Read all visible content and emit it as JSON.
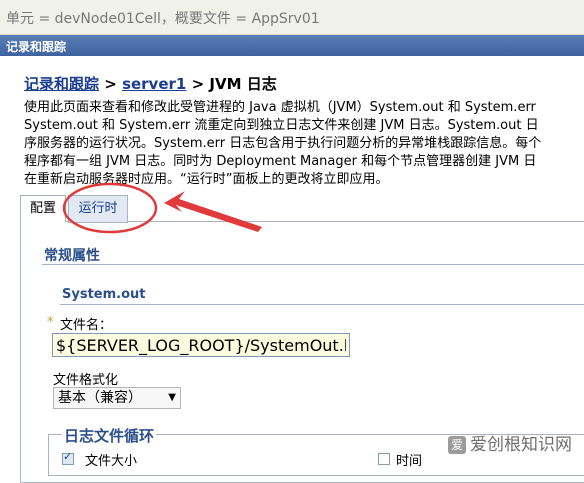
{
  "scope": {
    "text": "单元 = devNode01Cell，概要文件 = AppSrv01"
  },
  "portlet": {
    "title": "记录和跟踪"
  },
  "breadcrumb": {
    "root": "记录和跟踪",
    "sep1": ">",
    "server": "server1",
    "sep2": ">",
    "current": "JVM 日志"
  },
  "description": [
    "使用此页面来查看和修改此受管进程的 Java 虚拟机（JVM）System.out 和 System.err",
    "System.out 和 System.err 流重定向到独立日志文件来创建 JVM 日志。System.out 日",
    "序服务器的运行状况。System.err 日志包含用于执行问题分析的异常堆栈跟踪信息。每个",
    "程序都有一组 JVM 日志。同时为 Deployment Manager 和每个节点管理器创建 JVM 日",
    "在重新启动服务器时应用。“运行时”面板上的更改将立即应用。"
  ],
  "tabs": {
    "config": "配置",
    "runtime": "运行时"
  },
  "general": {
    "title": "常规属性"
  },
  "sysout": {
    "title": "System.out",
    "required_mark": "*",
    "file_label": "文件名：",
    "file_value": "${SERVER_LOG_ROOT}/SystemOut.log",
    "format_label": "文件格式化",
    "format_value": "基本（兼容）"
  },
  "rotation": {
    "title": "日志文件循环",
    "size_label": "文件大小",
    "time_label": "时间"
  },
  "watermark": {
    "badge": "爱",
    "text": "爱创根知识网"
  },
  "colors": {
    "annotation": "#e03a3a",
    "link": "#1b3d8f",
    "header": "#4a6fa9"
  }
}
